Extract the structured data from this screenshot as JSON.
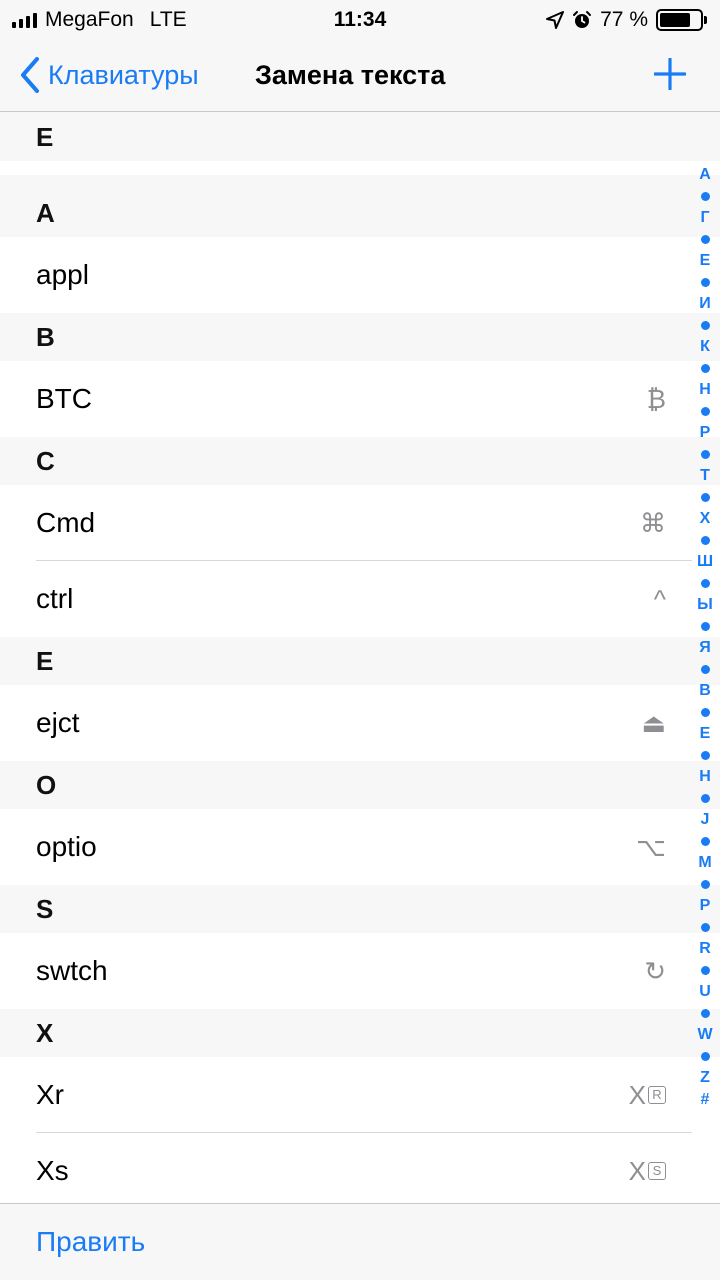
{
  "status_bar": {
    "carrier": "MegaFon",
    "network": "LTE",
    "time": "11:34",
    "battery_percent": "77 %",
    "battery_level": 0.77
  },
  "nav": {
    "back_label": "Клавиатуры",
    "title": "Замена текста",
    "add_icon": "plus-icon"
  },
  "top_section": "E",
  "sections": [
    {
      "header": "A",
      "items": [
        {
          "phrase": "appl",
          "symbol": ""
        }
      ]
    },
    {
      "header": "B",
      "items": [
        {
          "phrase": "BTC",
          "symbol": "₿"
        }
      ]
    },
    {
      "header": "C",
      "items": [
        {
          "phrase": "Cmd",
          "symbol": "⌘"
        },
        {
          "phrase": "ctrl",
          "symbol": "^"
        }
      ]
    },
    {
      "header": "E",
      "items": [
        {
          "phrase": "ejct",
          "symbol": "⏏"
        }
      ]
    },
    {
      "header": "O",
      "items": [
        {
          "phrase": "optio",
          "symbol": "⌥"
        }
      ]
    },
    {
      "header": "S",
      "items": [
        {
          "phrase": "swtch",
          "symbol": "↻"
        }
      ]
    },
    {
      "header": "X",
      "items": [
        {
          "phrase": "Xr",
          "symbol": "X",
          "boxed": "R"
        },
        {
          "phrase": "Xs",
          "symbol": "X",
          "boxed": "S"
        }
      ]
    }
  ],
  "index_letters": [
    "A",
    "Г",
    "Е",
    "И",
    "К",
    "Н",
    "Р",
    "Т",
    "Х",
    "Ш",
    "Ы",
    "Я",
    "B",
    "E",
    "H",
    "J",
    "M",
    "P",
    "R",
    "U",
    "W",
    "Z",
    "#"
  ],
  "toolbar": {
    "edit_label": "Править"
  },
  "colors": {
    "accent": "#1a7cf5",
    "background": "#f7f7f7",
    "secondary": "#8e8e93"
  }
}
